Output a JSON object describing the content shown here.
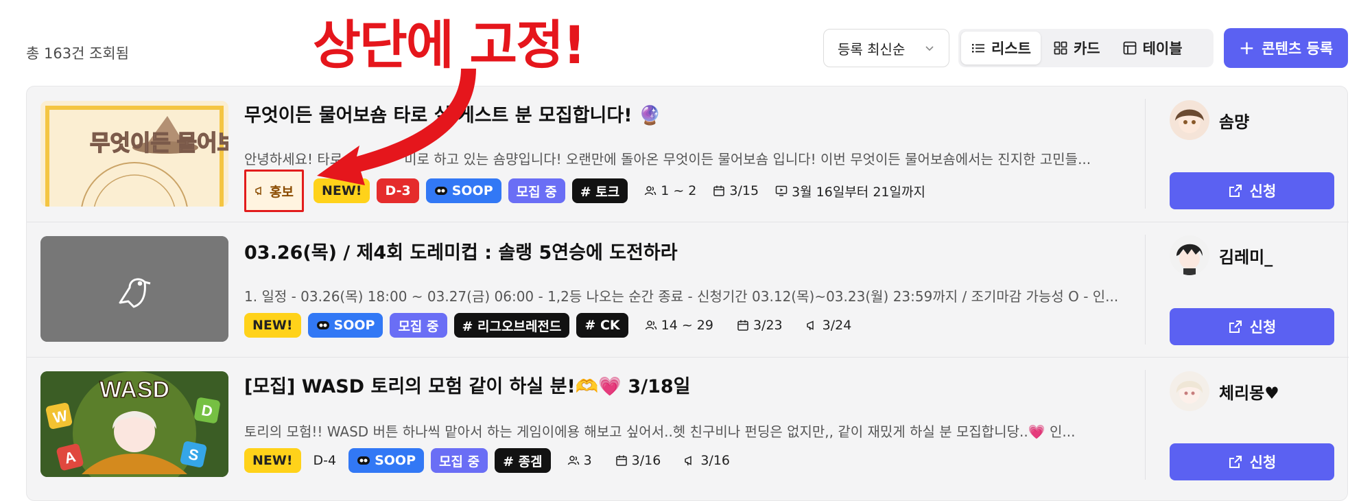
{
  "toolbar": {
    "total_count": "총 163건 조회됨",
    "sort_value": "등록 최신순",
    "views": [
      {
        "label": "리스트",
        "icon": "list-icon",
        "active": true
      },
      {
        "label": "카드",
        "icon": "grid-icon",
        "active": false
      },
      {
        "label": "테이블",
        "icon": "table-icon",
        "active": false
      }
    ],
    "register_label": "콘텐츠 등록",
    "accent_color": "#5b61f2"
  },
  "annotation": {
    "text": "상단에 고정!",
    "color": "#e5161c"
  },
  "rows": [
    {
      "title": "무엇이든 물어보숌 타로 ",
      "title_tail": "실 게스트 분 모집합니다! 🔮",
      "description": "안녕하세요! 타로",
      "description_tail": "미로 하고 있는 숌먕입니다!   오랜만에 돌아온 무엇이든 물어보숌 입니다!   이번 무엇이든 물어보숌에서는 진지한 고민들...",
      "thumb_text": "무엇이든 물어보숌",
      "promo_label": "홍보",
      "new_label": "NEW!",
      "dday_label": "D-3",
      "platform_label": "SOOP",
      "status_label": "모집 중",
      "tags": [
        "# 토크"
      ],
      "people": "1 ~ 2",
      "date": "3/15",
      "period": "3월 16일부터 21일까지",
      "author": "솜먕",
      "apply_label": "신청"
    },
    {
      "title": "03.26(목) / 제4회 도레미컵 : 솔랭 5연승에 도전하라",
      "description": "1. 일정 - 03.26(목) 18:00 ~ 03.27(금) 06:00 - 1,2등 나오는 순간 종료 - 신청기간 03.12(목)~03.23(월) 23:59까지 / 조기마감 가능성 O - 인...",
      "new_label": "NEW!",
      "platform_label": "SOOP",
      "status_label": "모집 중",
      "tags": [
        "# 리그오브레전드",
        "# CK"
      ],
      "people": "14 ~ 29",
      "date": "3/23",
      "promo_date": "3/24",
      "author": "김레미_",
      "apply_label": "신청"
    },
    {
      "title": "[모집] WASD 토리의 모험 같이 하실 분!🫶💗 3/18일",
      "description": "토리의 모험!!  WASD 버튼 하나씩 맡아서 하는 게임이에용   해보고 싶어서..헷  친구비나 펀딩은 없지만,, 같이 재밌게 하실 분 모집합니당..💗   인...",
      "thumb_text": "WASD",
      "new_label": "NEW!",
      "dday_label": "D-4",
      "platform_label": "SOOP",
      "status_label": "모집 중",
      "tags": [
        "# 종겜"
      ],
      "people": "3",
      "date": "3/16",
      "promo_date": "3/16",
      "author": "체리몽♥",
      "apply_label": "신청"
    }
  ]
}
